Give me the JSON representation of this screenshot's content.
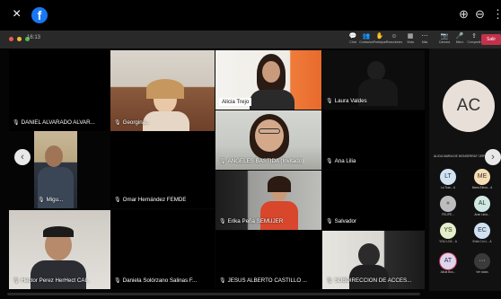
{
  "fb": {
    "close": "×",
    "logo": "f",
    "zoom_in": "⊕",
    "zoom_out": "⊖",
    "more": "⋮"
  },
  "teams": {
    "meeting_time": "16:13",
    "tools": [
      {
        "icon": "💬",
        "label": "Chat"
      },
      {
        "icon": "👥",
        "label": "Contactos"
      },
      {
        "icon": "✋",
        "label": "Participar"
      },
      {
        "icon": "☺",
        "label": "Reacciones"
      },
      {
        "icon": "▦",
        "label": "Vista"
      },
      {
        "icon": "⋯",
        "label": "Más"
      },
      {
        "icon": "📷",
        "label": "Cámara"
      },
      {
        "icon": "🎤",
        "label": "Micro"
      },
      {
        "icon": "⇪",
        "label": "Compartir"
      }
    ],
    "leave": "Salir"
  },
  "tiles": [
    {
      "name": "DANIEL ALVARADO ALVAR..."
    },
    {
      "name": "Georgina..."
    },
    {
      "name": "Alicia Trejo"
    },
    {
      "name": "Laura Valdes"
    },
    {
      "name": "Migu..."
    },
    {
      "name": "Omar Hernández FEMDE"
    },
    {
      "name": "ANGELES BASTIDA (Invitado)"
    },
    {
      "name": "Ana Lilia"
    },
    {
      "name": "Erika Peña SEMUJER"
    },
    {
      "name": "Salvador"
    },
    {
      "name": "Hector Perez HerHect CAI..."
    },
    {
      "name": "Daniela Solórzano Salinas F..."
    },
    {
      "name": "JESUS ALBERTO CASTILLO ..."
    },
    {
      "name": "SUBDIRECCION DE ACCES..."
    }
  ],
  "roster": {
    "big_initials": "AC",
    "title": "ALICIA MARIA DE MONSERRAT CERVANTES...",
    "people": [
      {
        "initials": "LT",
        "label": "La Tras... A",
        "color": "#cfe3f3"
      },
      {
        "initials": "ME",
        "label": "Maria Elena... A",
        "color": "#f6dcb4"
      },
      {
        "initials": "",
        "label": "FELIPE...",
        "color": "#bdbdbd"
      },
      {
        "initials": "AL",
        "label": "Aran Lima...",
        "color": "#cfe8e2"
      },
      {
        "initials": "YS",
        "label": "YOLI LOZ... A",
        "color": "#e4eec8"
      },
      {
        "initials": "EC",
        "label": "Erick Co Li... A",
        "color": "#cfe0f3"
      },
      {
        "initials": "AT",
        "label": "Alicia Bus...",
        "color": "#ddd4ee"
      },
      {
        "initials": "···",
        "label": "Ver todos",
        "color": "#3a3a3a"
      }
    ]
  }
}
